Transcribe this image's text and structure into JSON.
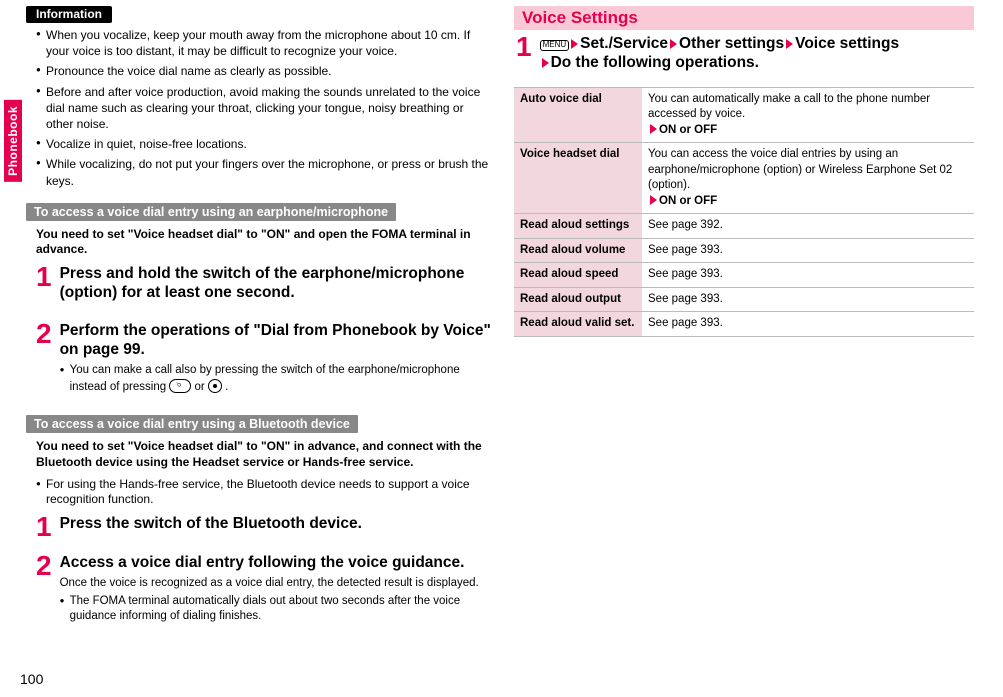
{
  "sidebar": {
    "label": "Phonebook"
  },
  "pageNumber": "100",
  "left": {
    "infoHeader": "Information",
    "infoItems": [
      "When you vocalize, keep your mouth away from the microphone about 10 cm. If your voice is too distant, it may be difficult to recognize your voice.",
      "Pronounce the voice dial name as clearly as possible.",
      "Before and after voice production, avoid making the sounds unrelated to the voice dial name such as clearing your throat, clicking your tongue, noisy breathing or other noise.",
      "Vocalize in quiet, noise-free locations.",
      "While vocalizing, do not put your fingers over the microphone, or press or brush the keys."
    ],
    "sec1": {
      "bar": "To access a voice dial entry using an earphone/microphone",
      "lead": "You need to set \"Voice headset dial\" to \"ON\" and open the FOMA terminal in advance.",
      "step1": "Press and hold the switch of the earphone/microphone (option) for at least one second.",
      "step2": "Perform the operations of \"Dial from Phonebook by Voice\" on page 99.",
      "step2note_pre": "You can make a call also by pressing the switch of the earphone/microphone instead of pressing ",
      "step2note_mid": " or ",
      "step2note_post": "."
    },
    "sec2": {
      "bar": "To access a voice dial entry using a Bluetooth device",
      "lead": "You need to set \"Voice headset dial\" to \"ON\" in advance, and connect with the Bluetooth device using the Headset service or Hands-free service.",
      "leadnote": "For using the Hands-free service, the Bluetooth device needs to support a voice recognition function.",
      "step1": "Press the switch of the Bluetooth device.",
      "step2": "Access a voice dial entry following the voice guidance.",
      "step2sub": "Once the voice is recognized as a voice dial entry, the detected result is displayed.",
      "step2note": "The FOMA terminal automatically dials out about two seconds after the voice guidance informing of dialing finishes."
    }
  },
  "right": {
    "title": "Voice Settings",
    "menuBadge": "MENU",
    "pathParts": [
      "Set./Service",
      "Other settings",
      "Voice settings"
    ],
    "pathTail": "Do the following operations.",
    "rows": [
      {
        "key": "Auto voice dial",
        "desc": "You can automatically make a call to the phone number accessed by voice.",
        "opt": "ON or OFF"
      },
      {
        "key": "Voice headset dial",
        "desc": "You can access the voice dial entries by using an earphone/microphone (option) or Wireless Earphone Set 02 (option).",
        "opt": "ON or OFF"
      },
      {
        "key": "Read aloud settings",
        "desc": "See page 392."
      },
      {
        "key": "Read aloud volume",
        "desc": "See page 393."
      },
      {
        "key": "Read aloud speed",
        "desc": "See page 393."
      },
      {
        "key": "Read aloud output",
        "desc": "See page 393."
      },
      {
        "key": "Read aloud valid set.",
        "desc": "See page 393."
      }
    ]
  }
}
